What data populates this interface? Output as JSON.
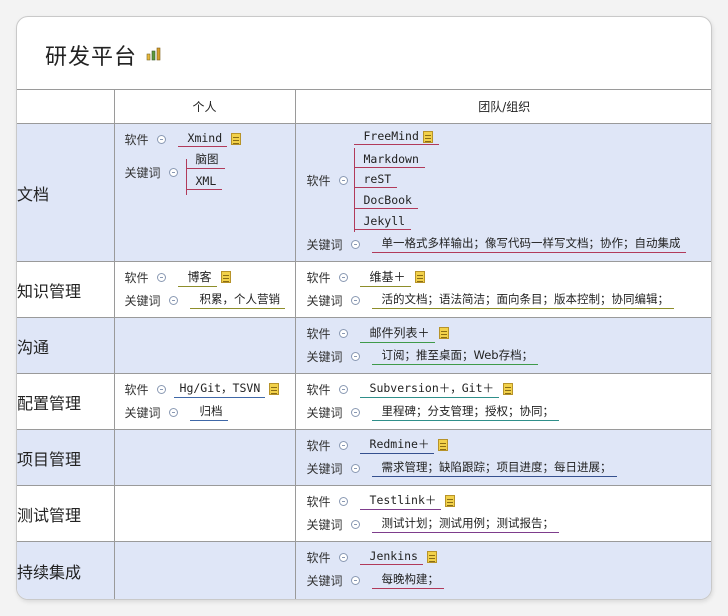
{
  "title": "研发平台",
  "header": {
    "c0": "",
    "personal": "个人",
    "team": "团队/组织"
  },
  "rows": [
    {
      "category": "文档",
      "personal": {
        "software_label": "软件",
        "software": "Xmind",
        "keywords_label": "关键词",
        "keywords": [
          "脑图",
          "XML"
        ]
      },
      "team": {
        "software_label": "软件",
        "software": [
          "FreeMind",
          "Markdown",
          "reST",
          "DocBook",
          "Jekyll"
        ],
        "keywords_label": "关键词",
        "keywords": "单一格式多样输出；像写代码一样写文档；协作；自动集成"
      }
    },
    {
      "category": "知识管理",
      "personal": {
        "software_label": "软件",
        "software": "博客",
        "keywords_label": "关键词",
        "keywords": "积累，个人营销"
      },
      "team": {
        "software_label": "软件",
        "software": "维基＋",
        "keywords_label": "关键词",
        "keywords": "活的文档；语法简洁；面向条目；版本控制；协同编辑；"
      }
    },
    {
      "category": "沟通",
      "team": {
        "software_label": "软件",
        "software": "邮件列表＋",
        "keywords_label": "关键词",
        "keywords": "订阅；推至桌面；Web存档；"
      }
    },
    {
      "category": "配置管理",
      "personal": {
        "software_label": "软件",
        "software": "Hg/Git，TSVN",
        "keywords_label": "关键词",
        "keywords": "归档"
      },
      "team": {
        "software_label": "软件",
        "software": "Subversion＋，Git＋",
        "keywords_label": "关键词",
        "keywords": "里程碑；分支管理；授权；协同；"
      }
    },
    {
      "category": "项目管理",
      "team": {
        "software_label": "软件",
        "software": "Redmine＋",
        "keywords_label": "关键词",
        "keywords": "需求管理；缺陷跟踪；项目进度；每日进展；"
      }
    },
    {
      "category": "测试管理",
      "team": {
        "software_label": "软件",
        "software": "Testlink＋",
        "keywords_label": "关键词",
        "keywords": "测试计划；测试用例；测试报告；"
      }
    },
    {
      "category": "持续集成",
      "team": {
        "software_label": "软件",
        "software": "Jenkins",
        "keywords_label": "关键词",
        "keywords": "每晚构建；"
      }
    }
  ],
  "icons": {
    "title": "chart-icon",
    "note": "note-icon",
    "collapse": "collapse-icon"
  },
  "colors": {
    "shaded_row": "#dfe6f7",
    "border": "#9a9a9a",
    "branch_red": "#b13a5a"
  }
}
